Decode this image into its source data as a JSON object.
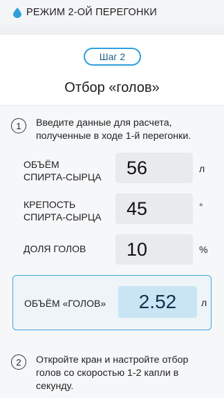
{
  "header": {
    "title": "РЕЖИМ 2-ОЙ ПЕРЕГОНКИ",
    "icon": "drop-icon",
    "accent": "#2f9fdc"
  },
  "step": {
    "badge": "Шаг 2",
    "title": "Отбор «голов»"
  },
  "instruction1": {
    "number": "1",
    "line1": "Введите данные для расчета,",
    "line2": "полученные в ходе 1-й перегонки."
  },
  "fields": [
    {
      "label_line1": "ОБЪЁМ",
      "label_line2": "СПИРТА-СЫРЦА",
      "value": "56",
      "unit": "л"
    },
    {
      "label_line1": "КРЕПОСТЬ",
      "label_line2": "СПИРТА-СЫРЦА",
      "value": "45",
      "unit": "°"
    },
    {
      "label_line1": "ДОЛЯ ГОЛОВ",
      "label_line2": "",
      "value": "10",
      "unit": "%"
    }
  ],
  "result": {
    "label": "ОБЪЁМ «ГОЛОВ»",
    "value": "2.52",
    "unit": "л"
  },
  "instruction2": {
    "number": "2",
    "line1": "Откройте кран и настройте отбор",
    "line2": "голов со скоростью 1-2 капли в",
    "line3": "секунду."
  }
}
